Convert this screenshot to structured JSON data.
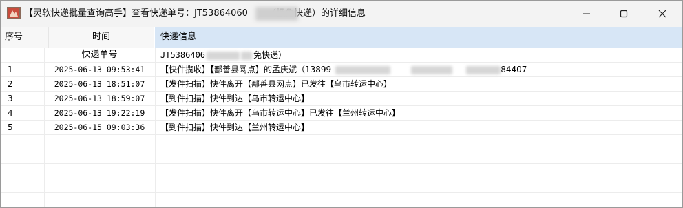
{
  "window": {
    "title_prefix": "【灵软快递批量查询高手】查看快递单号：JT53864060",
    "title_suffix": "（极免快递）的详细信息"
  },
  "table": {
    "headers": [
      "序号",
      "时间",
      "快递信息"
    ],
    "tracking_label": "快递单号",
    "tracking_value_prefix": "JT5386406",
    "tracking_value_suffix": "免快递）",
    "rows": [
      {
        "seq": "1",
        "time": "2025-06-13 09:53:41",
        "info": "【快件揽收】【鄯善县网点】的孟庆斌（13899",
        "info_tail": "84407"
      },
      {
        "seq": "2",
        "time": "2025-06-13 18:51:07",
        "info": "【发件扫描】快件离开【鄯善县网点】已发往【乌市转运中心】"
      },
      {
        "seq": "3",
        "time": "2025-06-13 18:59:07",
        "info": "【到件扫描】快件到达【乌市转运中心】"
      },
      {
        "seq": "4",
        "time": "2025-06-13 19:22:19",
        "info": "【发件扫描】快件离开【乌市转运中心】已发往【兰州转运中心】"
      },
      {
        "seq": "5",
        "time": "2025-06-15 09:03:36",
        "info": "【到件扫描】快件到达【兰州转运中心】"
      }
    ]
  },
  "icons": {
    "app": "app-icon",
    "minimize": "minimize-icon",
    "maximize": "maximize-icon",
    "close": "close-icon"
  }
}
